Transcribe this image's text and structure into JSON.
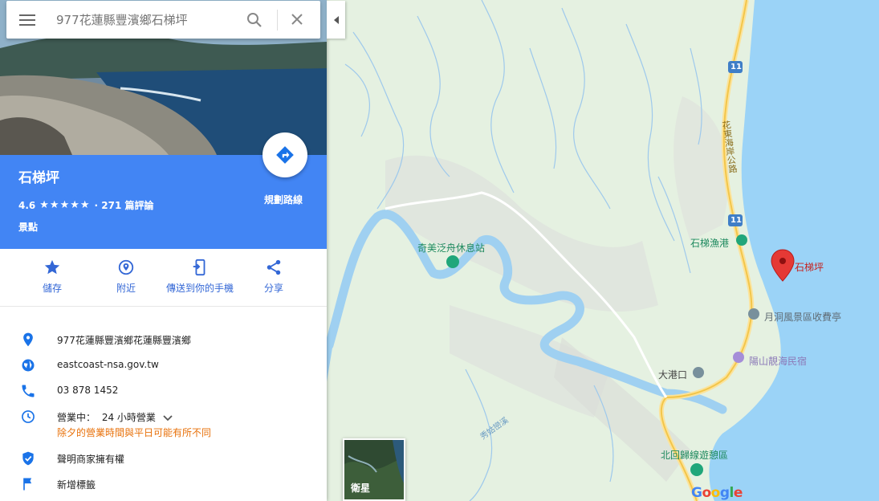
{
  "search": {
    "placeholder": "977花蓮縣豐濱鄉石梯坪"
  },
  "place": {
    "title": "石梯坪",
    "rating": "4.6",
    "stars": "★★★★★",
    "reviews": "· 271 篇評論",
    "category": "景點",
    "directions_label": "規劃路線"
  },
  "actions": [
    {
      "label": "儲存",
      "icon": "star-icon"
    },
    {
      "label": "附近",
      "icon": "nearby-icon"
    },
    {
      "label": "傳送到你的手機",
      "icon": "send-to-phone-icon"
    },
    {
      "label": "分享",
      "icon": "share-icon"
    }
  ],
  "details": {
    "address": "977花蓮縣豐濱鄉花蓮縣豐濱鄉",
    "website": "eastcoast-nsa.gov.tw",
    "phone": "03 878 1452",
    "hours_status": "營業中：",
    "hours": "24 小時營業",
    "hours_note": "除夕的營業時間與平日可能有所不同",
    "claim": "聲明商家擁有權",
    "add_label": "新增標籤"
  },
  "map": {
    "labels": {
      "pin": "石梯坪",
      "rest_stop": "奇美泛舟休息站",
      "harbor": "石梯漁港",
      "toll": "月洞風景區收費亭",
      "homestay": "陽山靚海民宿",
      "dagangkou": "大港口",
      "tropic": "北回歸線遊憩區",
      "highway": "花東海岸公路",
      "river": "秀姑巒溪",
      "route_no": "11"
    },
    "satellite_label": "衛星",
    "logo": "Google"
  },
  "colors": {
    "accent": "#4285f4",
    "action": "#3367d6",
    "sea": "#9bd3f7",
    "river": "#9fd0f1",
    "land": "#e8f3e6",
    "road": "#f6d86b",
    "pin": "#e53935",
    "note": "#e8710a"
  }
}
